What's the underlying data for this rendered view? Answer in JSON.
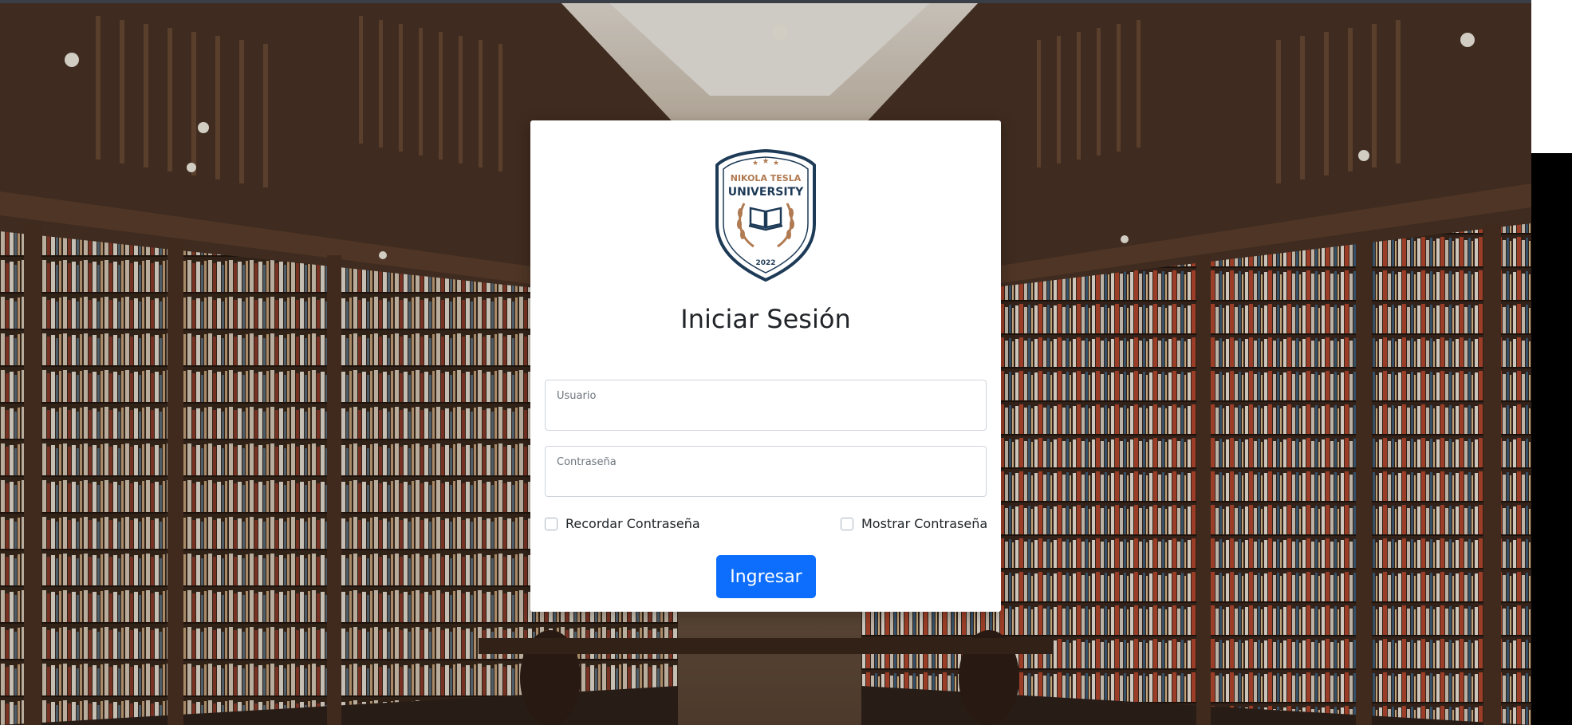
{
  "login": {
    "title": "Iniciar Sesión",
    "username": {
      "label": "Usuario",
      "value": ""
    },
    "password": {
      "label": "Contraseña",
      "value": ""
    },
    "remember_label": "Recordar Contraseña",
    "show_password_label": "Mostrar Contraseña",
    "submit_label": "Ingresar"
  },
  "logo": {
    "line1": "NIKOLA TESLA",
    "line2": "UNIVERSITY",
    "year": "2022"
  },
  "colors": {
    "primary_button": "#0d6efd",
    "logo_navy": "#1d3a57",
    "logo_copper": "#b07a52"
  },
  "icons": {
    "background": "library-bookshelves-photo",
    "logo": "university-shield-crest-icon"
  }
}
